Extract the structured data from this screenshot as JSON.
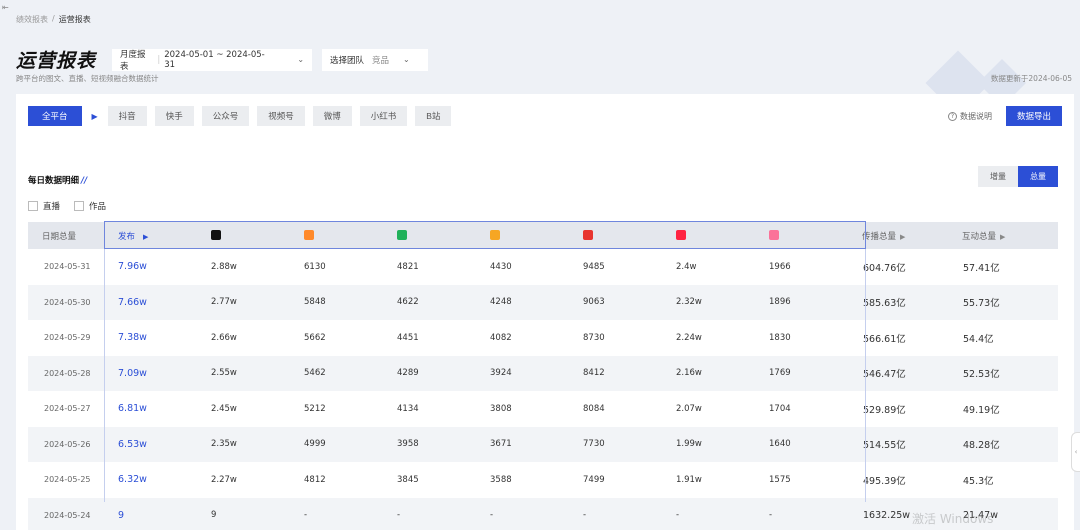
{
  "breadcrumb": {
    "parent": "绩效报表",
    "separator": "/",
    "current": "运营报表"
  },
  "header": {
    "title": "运营报表",
    "report_type": "月度报表",
    "date_range": "2024-05-01 ~ 2024-05-31",
    "team_label": "选择团队",
    "team_value": "竞品",
    "subtitle": "跨平台的图文、直播、短视频融合数据统计",
    "update_time": "数据更新于2024-06-05"
  },
  "platforms": {
    "all": "全平台",
    "items": [
      "抖音",
      "快手",
      "公众号",
      "视频号",
      "微博",
      "小红书",
      "B站"
    ]
  },
  "actions": {
    "explain": "数据说明",
    "export": "数据导出"
  },
  "section": {
    "title": "每日数据明细",
    "slashes": "//",
    "toggle": {
      "increment": "增量",
      "total": "总量"
    },
    "filters": [
      "直播",
      "作品"
    ]
  },
  "table": {
    "headers": {
      "date": "日期总量",
      "publish": "发布",
      "spread": "传播总量",
      "interact": "互动总量"
    },
    "platform_icons": [
      {
        "name": "douyin-icon",
        "color": "#111111"
      },
      {
        "name": "kuaishou-icon",
        "color": "#ff8a2b"
      },
      {
        "name": "wechat-official-icon",
        "color": "#20b15a"
      },
      {
        "name": "wechat-channels-icon",
        "color": "#f6a623"
      },
      {
        "name": "weibo-icon",
        "color": "#e8352f"
      },
      {
        "name": "xiaohongshu-icon",
        "color": "#ff2442"
      },
      {
        "name": "bilibili-icon",
        "color": "#fb7299"
      }
    ],
    "rows": [
      [
        "2024-05-31",
        "7.96w",
        "2.88w",
        "6130",
        "4821",
        "4430",
        "9485",
        "2.4w",
        "1966",
        "604.76亿",
        "57.41亿"
      ],
      [
        "2024-05-30",
        "7.66w",
        "2.77w",
        "5848",
        "4622",
        "4248",
        "9063",
        "2.32w",
        "1896",
        "585.63亿",
        "55.73亿"
      ],
      [
        "2024-05-29",
        "7.38w",
        "2.66w",
        "5662",
        "4451",
        "4082",
        "8730",
        "2.24w",
        "1830",
        "566.61亿",
        "54.4亿"
      ],
      [
        "2024-05-28",
        "7.09w",
        "2.55w",
        "5462",
        "4289",
        "3924",
        "8412",
        "2.16w",
        "1769",
        "546.47亿",
        "52.53亿"
      ],
      [
        "2024-05-27",
        "6.81w",
        "2.45w",
        "5212",
        "4134",
        "3808",
        "8084",
        "2.07w",
        "1704",
        "529.89亿",
        "49.19亿"
      ],
      [
        "2024-05-26",
        "6.53w",
        "2.35w",
        "4999",
        "3958",
        "3671",
        "7730",
        "1.99w",
        "1640",
        "514.55亿",
        "48.28亿"
      ],
      [
        "2024-05-25",
        "6.32w",
        "2.27w",
        "4812",
        "3845",
        "3588",
        "7499",
        "1.91w",
        "1575",
        "495.39亿",
        "45.3亿"
      ],
      [
        "2024-05-24",
        "9",
        "9",
        "-",
        "-",
        "-",
        "-",
        "-",
        "-",
        "1632.25w",
        "21.47w"
      ]
    ]
  },
  "watermark": "激活 Windows"
}
